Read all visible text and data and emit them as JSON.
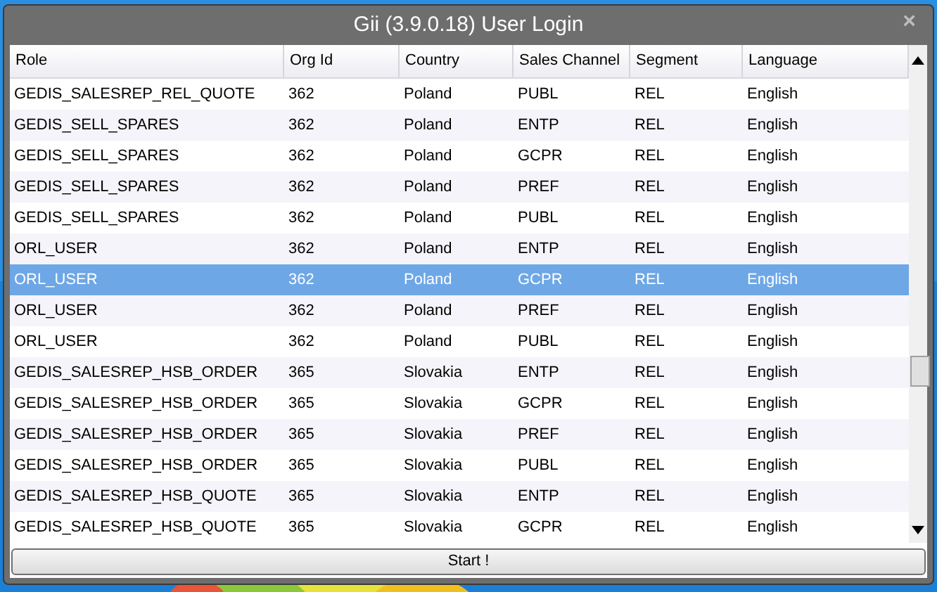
{
  "window": {
    "title": "Gii (3.9.0.18) User Login",
    "close": "×"
  },
  "table": {
    "columns": [
      "Role",
      "Org Id",
      "Country",
      "Sales Channel",
      "Segment",
      "Language"
    ],
    "rows": [
      {
        "cells": [
          "GEDIS_SALESREP_REL_QUOTE",
          "362",
          "Poland",
          "PUBL",
          "REL",
          "English"
        ],
        "selected": false
      },
      {
        "cells": [
          "GEDIS_SELL_SPARES",
          "362",
          "Poland",
          "ENTP",
          "REL",
          "English"
        ],
        "selected": false
      },
      {
        "cells": [
          "GEDIS_SELL_SPARES",
          "362",
          "Poland",
          "GCPR",
          "REL",
          "English"
        ],
        "selected": false
      },
      {
        "cells": [
          "GEDIS_SELL_SPARES",
          "362",
          "Poland",
          "PREF",
          "REL",
          "English"
        ],
        "selected": false
      },
      {
        "cells": [
          "GEDIS_SELL_SPARES",
          "362",
          "Poland",
          "PUBL",
          "REL",
          "English"
        ],
        "selected": false
      },
      {
        "cells": [
          "ORL_USER",
          "362",
          "Poland",
          "ENTP",
          "REL",
          "English"
        ],
        "selected": false
      },
      {
        "cells": [
          "ORL_USER",
          "362",
          "Poland",
          "GCPR",
          "REL",
          "English"
        ],
        "selected": true
      },
      {
        "cells": [
          "ORL_USER",
          "362",
          "Poland",
          "PREF",
          "REL",
          "English"
        ],
        "selected": false
      },
      {
        "cells": [
          "ORL_USER",
          "362",
          "Poland",
          "PUBL",
          "REL",
          "English"
        ],
        "selected": false
      },
      {
        "cells": [
          "GEDIS_SALESREP_HSB_ORDER",
          "365",
          "Slovakia",
          "ENTP",
          "REL",
          "English"
        ],
        "selected": false
      },
      {
        "cells": [
          "GEDIS_SALESREP_HSB_ORDER",
          "365",
          "Slovakia",
          "GCPR",
          "REL",
          "English"
        ],
        "selected": false
      },
      {
        "cells": [
          "GEDIS_SALESREP_HSB_ORDER",
          "365",
          "Slovakia",
          "PREF",
          "REL",
          "English"
        ],
        "selected": false
      },
      {
        "cells": [
          "GEDIS_SALESREP_HSB_ORDER",
          "365",
          "Slovakia",
          "PUBL",
          "REL",
          "English"
        ],
        "selected": false
      },
      {
        "cells": [
          "GEDIS_SALESREP_HSB_QUOTE",
          "365",
          "Slovakia",
          "ENTP",
          "REL",
          "English"
        ],
        "selected": false
      },
      {
        "cells": [
          "GEDIS_SALESREP_HSB_QUOTE",
          "365",
          "Slovakia",
          "GCPR",
          "REL",
          "English"
        ],
        "selected": false
      }
    ]
  },
  "button": {
    "label": "Start !"
  }
}
